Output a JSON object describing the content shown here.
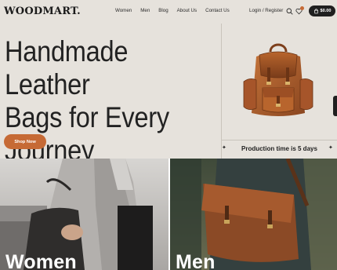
{
  "header": {
    "logo": "WOODMART.",
    "nav": [
      "Women",
      "Men",
      "Blog",
      "About Us",
      "Contact Us"
    ],
    "login_label": "Login / Register",
    "cart_amount": "$0.00"
  },
  "hero": {
    "title_lines": [
      "Handmade Leather",
      "Bags for Every",
      "Journey"
    ],
    "button_label": "Shop Now",
    "product_caption": "Production time is 5 days",
    "prev_arrow": "✦",
    "next_arrow": "✦"
  },
  "categories": [
    {
      "label": "Women"
    },
    {
      "label": "Men"
    }
  ],
  "colors": {
    "background": "#e6e2dc",
    "accent": "#c66a35",
    "dark": "#1f1f1f"
  },
  "icons": [
    "search-icon",
    "heart-icon",
    "cart-icon",
    "arrow-icon"
  ]
}
